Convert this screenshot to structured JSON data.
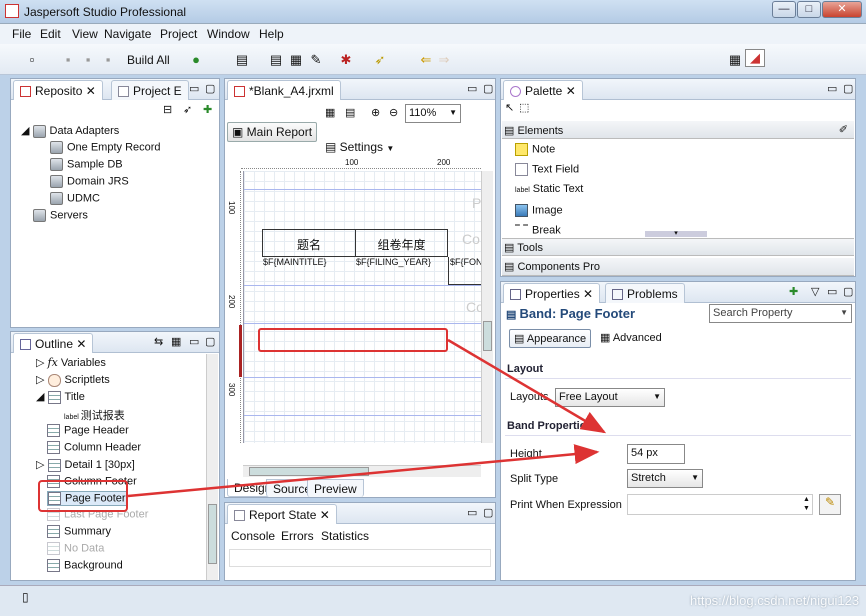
{
  "window": {
    "title": "Jaspersoft Studio Professional",
    "min": "—",
    "max": "□",
    "close": "✕"
  },
  "menu": [
    "File",
    "Edit",
    "View",
    "Navigate",
    "Project",
    "Window",
    "Help"
  ],
  "toolbar": {
    "build_all": "Build All"
  },
  "repo": {
    "tabs": [
      "Reposito",
      "Project E"
    ],
    "items": [
      "Data Adapters",
      "One Empty Record",
      "Sample DB",
      "Domain JRS",
      "UDMC",
      "Servers"
    ]
  },
  "outline": {
    "tab": "Outline",
    "items": [
      "Variables",
      "Scriptlets",
      "Title",
      "测试报表",
      "Page Header",
      "Column Header",
      "Detail 1 [30px]",
      "Column Footer",
      "Page Footer",
      "Last Page Footer",
      "Summary",
      "No Data",
      "Background"
    ]
  },
  "editor": {
    "tab": "*Blank_A4.jrxml",
    "zoom": "110%",
    "main_report": "Main Report",
    "settings": "Settings",
    "ruler": [
      "100",
      "200"
    ],
    "side_ruler": [
      "100",
      "200",
      "300"
    ],
    "headers": [
      "题名",
      "组卷年度"
    ],
    "fields": [
      "$F{MAINTITLE}",
      "$F{FILING_YEAR}",
      "$F{FON"
    ],
    "clip1": "P",
    "clip2": "Co",
    "clip3": "Co",
    "bottom_tabs": [
      "Design",
      "Source",
      "Preview"
    ]
  },
  "report_state": {
    "tab": "Report State",
    "subtabs": [
      "Console",
      "Errors",
      "Statistics"
    ]
  },
  "palette": {
    "tab": "Palette",
    "elements": "Elements",
    "items": [
      "Note",
      "Text Field",
      "Static Text",
      "Image",
      "Break"
    ],
    "label_badge": "label",
    "tools": "Tools",
    "components": "Components Pro"
  },
  "properties": {
    "tabs": [
      "Properties",
      "Problems"
    ],
    "band_title": "Band: Page Footer",
    "search_placeholder": "Search Property",
    "appearance": "Appearance",
    "advanced": "Advanced",
    "layout_section": "Layout",
    "layouts_label": "Layouts",
    "layouts_value": "Free Layout",
    "band_section": "Band Properties",
    "height_label": "Height",
    "height_value": "54 px",
    "split_label": "Split Type",
    "split_value": "Stretch",
    "print_when_label": "Print When Expression"
  },
  "watermark": "https://blog.csdn.net/nigui123"
}
